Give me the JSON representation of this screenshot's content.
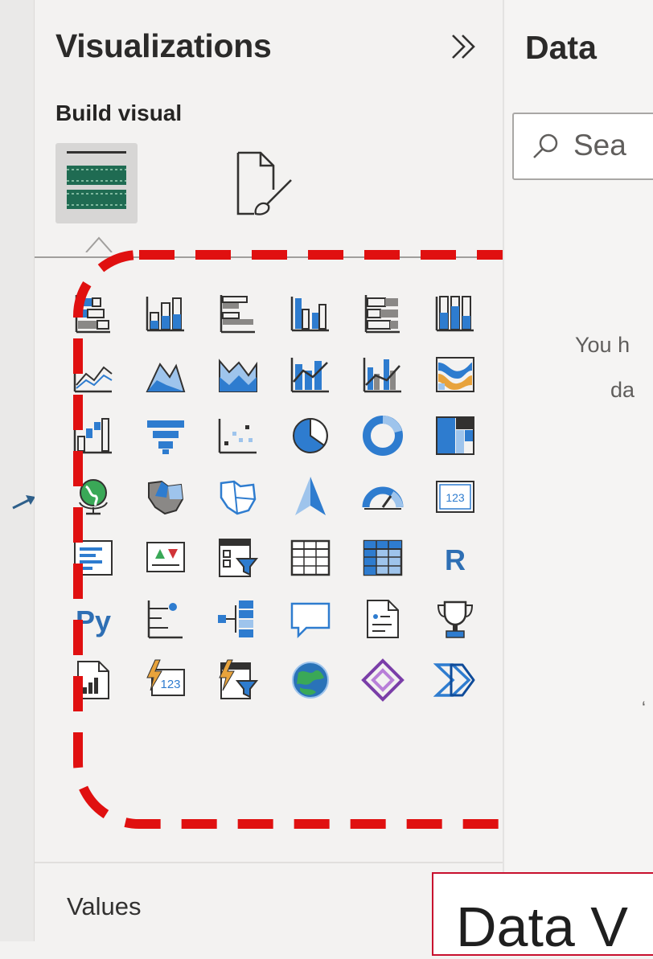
{
  "visualizations_pane": {
    "title": "Visualizations",
    "build_visual_label": "Build visual",
    "icons": [
      "stacked-bar-chart-icon",
      "stacked-column-chart-icon",
      "clustered-bar-chart-icon",
      "clustered-column-chart-icon",
      "100-stacked-bar-chart-icon",
      "100-stacked-column-chart-icon",
      "line-chart-icon",
      "area-chart-icon",
      "stacked-area-chart-icon",
      "line-and-stacked-column-chart-icon",
      "line-and-clustered-column-chart-icon",
      "ribbon-chart-icon",
      "waterfall-chart-icon",
      "funnel-icon",
      "scatter-chart-icon",
      "pie-chart-icon",
      "donut-chart-icon",
      "treemap-icon",
      "map-icon",
      "filled-map-icon",
      "shape-map-icon",
      "azure-map-icon",
      "gauge-icon",
      "card-icon",
      "multi-row-card-icon",
      "kpi-icon",
      "slicer-icon",
      "table-icon",
      "matrix-icon",
      "r-script-visual-icon",
      "python-visual-icon",
      "key-influencers-icon",
      "decomposition-tree-icon",
      "qa-icon",
      "smart-narrative-icon",
      "metrics-icon",
      "paginated-report-icon",
      "new-card-icon",
      "new-slicer-icon",
      "arcgis-map-icon",
      "power-apps-icon",
      "power-automate-icon"
    ],
    "r_label": "R",
    "py_label": "Py",
    "card_label": "123",
    "new_card_label": "123",
    "values_label": "Values"
  },
  "data_pane": {
    "title": "Data",
    "search_placeholder": "Sea",
    "empty_line1": "You h",
    "empty_line2": "da",
    "tiny_mark": "‘"
  },
  "report_canvas": {
    "title_fragment": "Data V"
  },
  "colors": {
    "pane_bg": "#f3f2f1",
    "icon_blue": "#2e7ccf",
    "icon_light_blue": "#9ec4ec",
    "icon_gray": "#8a8886",
    "icon_dark": "#323130",
    "highlight_red": "#e01010",
    "build_icon_green": "#1f6b52"
  }
}
